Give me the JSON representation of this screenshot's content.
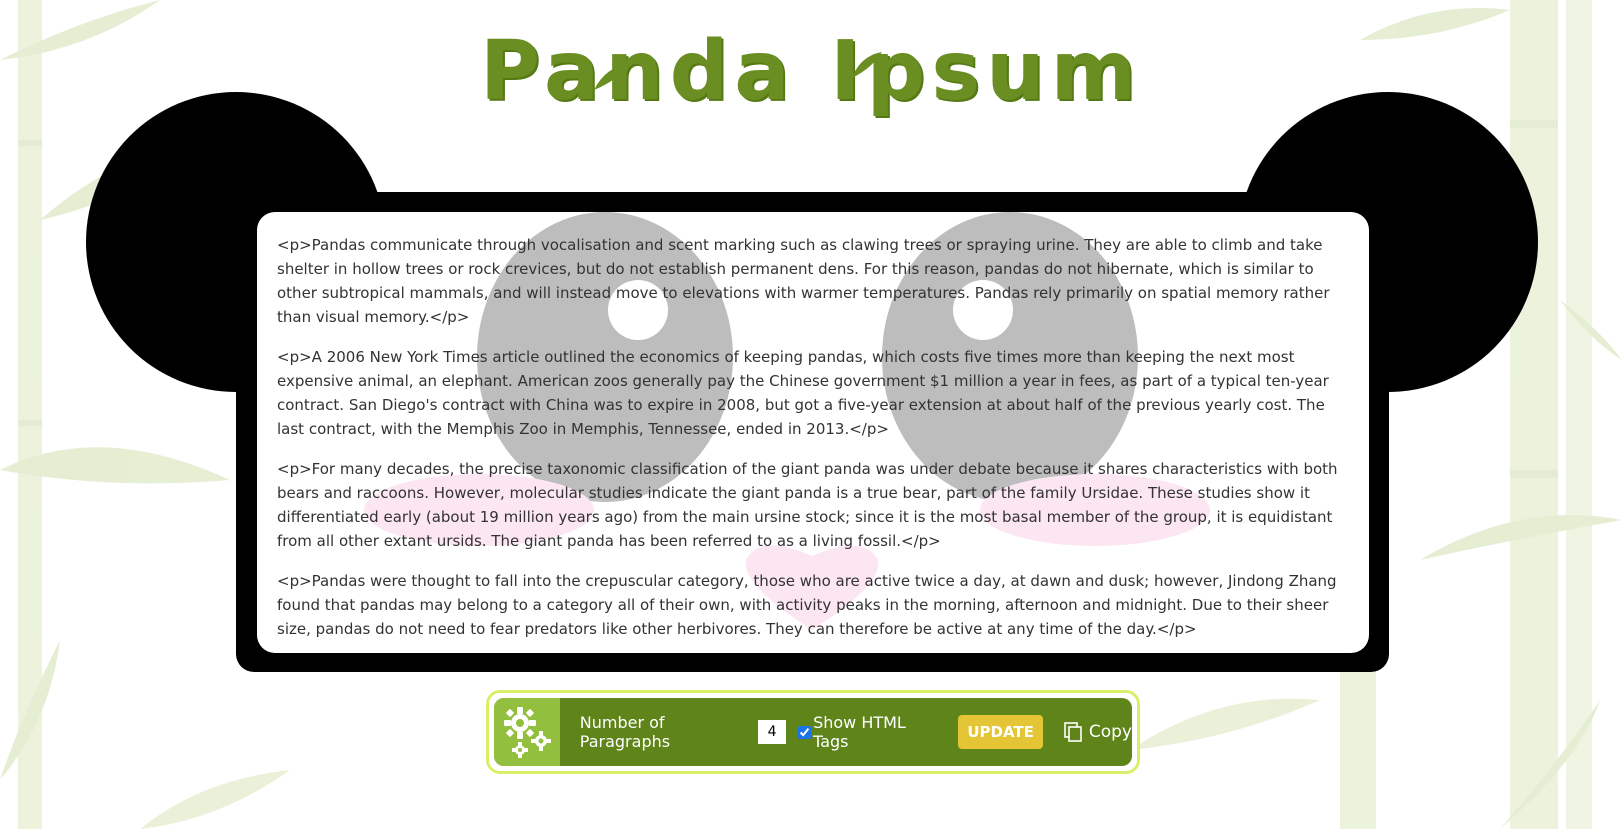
{
  "title": "Panda Ipsum",
  "paragraphs": [
    "<p>Pandas communicate through vocalisation and scent marking such as clawing trees or spraying urine. They are able to climb and take shelter in hollow trees or rock crevices, but do not establish permanent dens. For this reason, pandas do not hibernate, which is similar to other subtropical mammals, and will instead move to elevations with warmer temperatures. Pandas rely primarily on spatial memory rather than visual memory.</p>",
    "<p>A 2006 New York Times article outlined the economics of keeping pandas, which costs five times more than keeping the next most expensive animal, an elephant. American zoos generally pay the Chinese government $1 million a year in fees, as part of a typical ten-year contract. San Diego's contract with China was to expire in 2008, but got a five-year extension at about half of the previous yearly cost. The last contract, with the Memphis Zoo in Memphis, Tennessee, ended in 2013.</p>",
    "<p>For many decades, the precise taxonomic classification of the giant panda was under debate because it shares characteristics with both bears and raccoons. However, molecular studies indicate the giant panda is a true bear, part of the family Ursidae. These studies show it differentiated early (about 19 million years ago) from the main ursine stock; since it is the most basal member of the group, it is equidistant from all other extant ursids. The giant panda has been referred to as a living fossil.</p>",
    "<p>Pandas were thought to fall into the crepuscular category, those who are active twice a day, at dawn and dusk; however, Jindong Zhang found that pandas may belong to a category all of their own, with activity peaks in the morning, afternoon and midnight. Due to their sheer size, pandas do not need to fear predators like other herbivores. They can therefore be active at any time of the day.</p>"
  ],
  "controls": {
    "settings_icon": "gears-icon",
    "paragraphs_label": "Number of Paragraphs",
    "paragraphs_value": "4",
    "show_tags_label": "Show HTML Tags",
    "show_tags_checked": true,
    "update_label": "UPDATE",
    "copy_label": "Copy",
    "copy_icon": "copy-icon"
  },
  "colors": {
    "title_green": "#6b8e23",
    "panel_green": "#5f851a",
    "gear_box_green": "#93bf3f",
    "border_lime": "#d8ef6a",
    "update_yellow": "#e4c536",
    "panda_black": "#000000",
    "eye_gray": "#bdbdbd",
    "cheek_pink": "#fbe6f2"
  }
}
